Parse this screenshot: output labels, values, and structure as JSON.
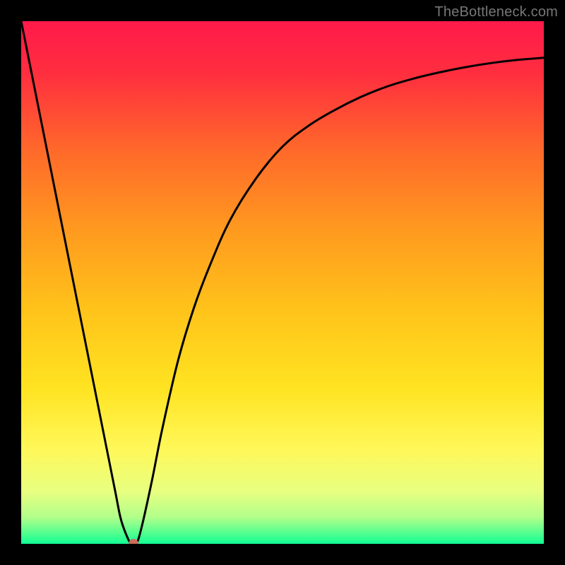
{
  "watermark": "TheBottleneck.com",
  "chart_data": {
    "type": "line",
    "title": "",
    "xlabel": "",
    "ylabel": "",
    "xlim": [
      0,
      100
    ],
    "ylim": [
      0,
      100
    ],
    "background_gradient": {
      "stops": [
        {
          "offset": 0.0,
          "color": "#ff1a4a"
        },
        {
          "offset": 0.1,
          "color": "#ff2e3f"
        },
        {
          "offset": 0.25,
          "color": "#ff6a2a"
        },
        {
          "offset": 0.4,
          "color": "#ff9a1f"
        },
        {
          "offset": 0.55,
          "color": "#ffc21a"
        },
        {
          "offset": 0.7,
          "color": "#ffe321"
        },
        {
          "offset": 0.82,
          "color": "#fff85a"
        },
        {
          "offset": 0.9,
          "color": "#e8ff80"
        },
        {
          "offset": 0.95,
          "color": "#b0ff8a"
        },
        {
          "offset": 1.0,
          "color": "#11ff94"
        }
      ]
    },
    "series": [
      {
        "name": "bottleneck-curve",
        "color": "#000000",
        "x": [
          0,
          2,
          4,
          6,
          8,
          10,
          12,
          14,
          16,
          18,
          19,
          20,
          21,
          22,
          23,
          25,
          27,
          30,
          33,
          36,
          40,
          45,
          50,
          55,
          60,
          65,
          70,
          75,
          80,
          85,
          90,
          95,
          100
        ],
        "y": [
          100,
          90,
          80,
          70,
          60,
          50,
          40,
          30,
          20,
          10,
          5,
          2,
          0,
          0,
          3,
          12,
          22,
          35,
          45,
          53,
          62,
          70,
          76,
          80,
          83,
          85.5,
          87.5,
          89,
          90.2,
          91.2,
          92,
          92.6,
          93
        ]
      }
    ],
    "marker": {
      "name": "optimal-point",
      "x": 21.5,
      "y": 0,
      "color": "#d06a5a",
      "radius": 7
    }
  }
}
